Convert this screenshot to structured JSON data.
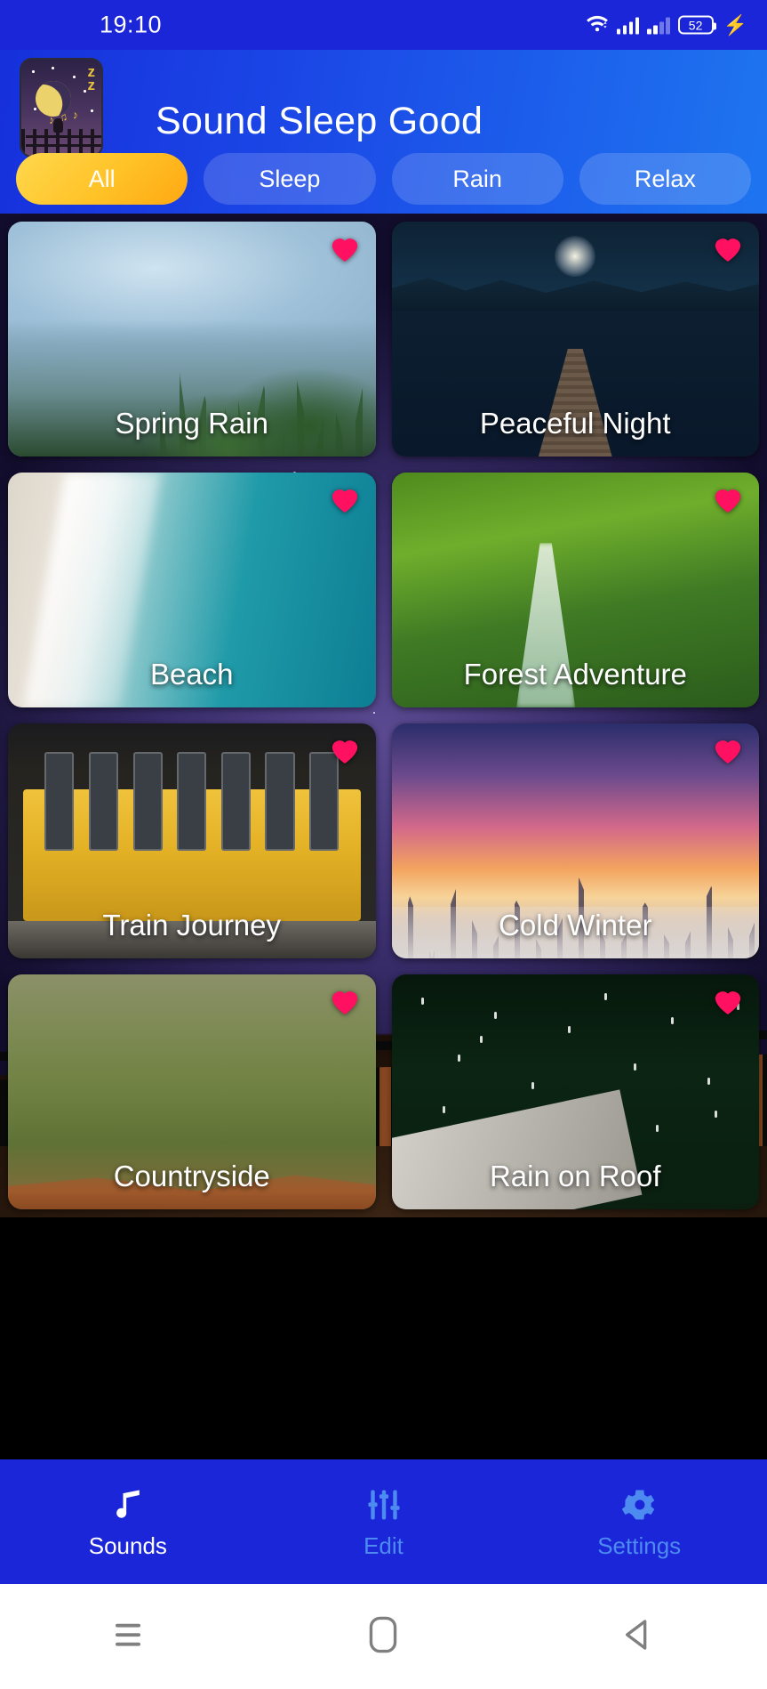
{
  "status_bar": {
    "time": "19:10",
    "battery_level": "52",
    "icons": [
      "wifi-icon",
      "signal-icon-1",
      "signal-icon-2",
      "battery-icon",
      "charging-bolt-icon"
    ]
  },
  "header": {
    "app_title": "Sound Sleep Good",
    "app_icon": "moon-sleep-app-icon",
    "background_color": "#1B47E6"
  },
  "tabs": {
    "items": [
      {
        "label": "All",
        "active": true
      },
      {
        "label": "Sleep",
        "active": false
      },
      {
        "label": "Rain",
        "active": false
      },
      {
        "label": "Relax",
        "active": false
      }
    ],
    "active_color": "#FFC227",
    "inactive_color": "rgba(255,255,255,0.16)"
  },
  "sounds": {
    "favorite_color": "#FF1060",
    "cards": [
      {
        "title": "Spring Rain",
        "favorite": true,
        "art": "ph-springrain"
      },
      {
        "title": "Peaceful Night",
        "favorite": true,
        "art": "ph-peaceful"
      },
      {
        "title": "Beach",
        "favorite": true,
        "art": "ph-beach"
      },
      {
        "title": "Forest Adventure",
        "favorite": true,
        "art": "ph-forest"
      },
      {
        "title": "Train Journey",
        "favorite": true,
        "art": "ph-train"
      },
      {
        "title": "Cold Winter",
        "favorite": true,
        "art": "ph-winter"
      },
      {
        "title": "Countryside",
        "favorite": true,
        "art": "ph-country"
      },
      {
        "title": "Rain on Roof",
        "favorite": true,
        "art": "ph-roof"
      }
    ]
  },
  "bottom_nav": {
    "background_color": "#1A26D8",
    "items": [
      {
        "label": "Sounds",
        "icon": "music-note-icon",
        "active": true
      },
      {
        "label": "Edit",
        "icon": "equalizer-sliders-icon",
        "active": false
      },
      {
        "label": "Settings",
        "icon": "gear-icon",
        "active": false
      }
    ],
    "active_color": "#FFFFFF",
    "inactive_color": "#4D8BF0"
  },
  "android_nav": {
    "buttons": [
      "recents-icon",
      "home-icon",
      "back-icon"
    ],
    "icon_color": "#808080",
    "background_color": "#FFFFFF"
  }
}
